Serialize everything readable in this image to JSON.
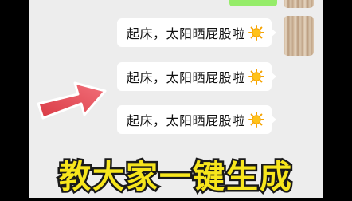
{
  "messages": [
    {
      "text": "起床，太阳晒屁股啦"
    },
    {
      "text": "起床，太阳晒屁股啦"
    },
    {
      "text": "起床，太阳晒屁股啦"
    }
  ],
  "caption": "教大家一键生成",
  "colors": {
    "chat_bg": "#ededed",
    "bubble_me": "#95ec69",
    "arrow": "#e8505b",
    "caption_fill": "#f7e61c"
  }
}
